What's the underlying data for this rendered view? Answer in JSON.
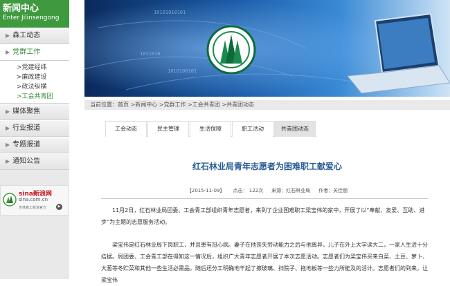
{
  "sidebar": {
    "title": "新闻中心",
    "subtitle": "Enter Jilinsengong",
    "items": [
      {
        "label": "森工动态"
      },
      {
        "label": "党群工作"
      },
      {
        "label": "媒体聚焦"
      },
      {
        "label": "行业报道"
      },
      {
        "label": "专题报道"
      },
      {
        "label": "通知公告"
      }
    ],
    "sub_items": [
      {
        "label": ">党建经纬"
      },
      {
        "label": ">廉政建设"
      },
      {
        "label": ">政法纵横"
      },
      {
        "label": ">工会共青团"
      }
    ],
    "sina": {
      "brand": "sina新浪网",
      "domain": "sina.com.cn",
      "account": "吉林森工新浪官方"
    }
  },
  "breadcrumb": {
    "text": "当前位置：首页 >新闻中心 >党群工作 >工会共青团 >共青团动态"
  },
  "tabs": [
    {
      "label": "工会动态"
    },
    {
      "label": "民主管理"
    },
    {
      "label": "生活保障"
    },
    {
      "label": "职工活动"
    },
    {
      "label": "共青团动态"
    }
  ],
  "article": {
    "title": "红石林业局青年志愿者为困难职工献爱心",
    "date": "【2015-11-09】",
    "clicks": "点击： 122次",
    "source": "来源：红石林业局",
    "author": "作者：关佳丽",
    "paragraph1": "11月2日，红石林业局团委、工会青工部组织青年志愿者，来到了企业困难职工梁宝伟的家中，开展了以“奉献、友爱、互助、进步”为主题的志愿服务活动。",
    "paragraph2": "梁宝伟是红石林业局下岗职工，并且患有冠心病。妻子在他丧失劳动能力之后与他离异，儿子在外上大学读大二，一家人生活十分拮据。局团委、工会青工部在得知这一情况后，组织广大青年志愿者开展了本次志愿活动。志愿者们为梁宝伟买来白菜、土豆、萝卜、大葱等冬贮菜和其他一些生活必需品，随后还分工明确地干起了擦玻璃、扫院子、拖地板等一些力所能及的活计。志愿者们的到来，让梁宝伟"
  },
  "colors": {
    "accent": "#3f9a3f",
    "title_blue": "#2a5d96"
  }
}
